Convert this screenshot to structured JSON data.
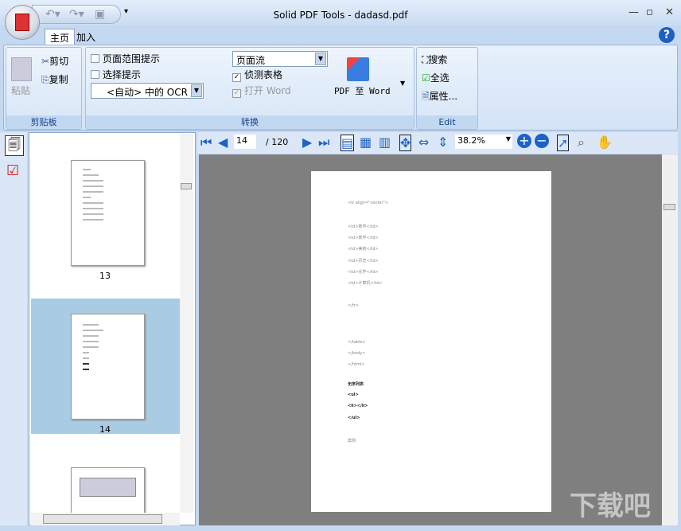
{
  "window": {
    "title": "Solid PDF Tools - dadasd.pdf",
    "minimize": "—",
    "maximize": "▫",
    "close": "✕"
  },
  "tabs": [
    "主页",
    "加入"
  ],
  "help": "?",
  "ribbon": {
    "clipboard": {
      "label": "剪贴板",
      "paste": "粘贴",
      "cut": "剪切",
      "copy": "复制"
    },
    "convert": {
      "label": "转换",
      "page_range_hint": "页面范围提示",
      "selection_hint": "选择提示",
      "ocr_select": "<自动> 中的 OCR",
      "layout_select": "页面流",
      "detect_tables": "侦测表格",
      "open_word": "打开 Word",
      "pdf_to_word": "PDF 至 Word",
      "detect_tables_checked": true,
      "open_word_checked": true
    },
    "edit": {
      "label": "Edit",
      "search": "搜索",
      "select_all": "全选",
      "properties": "属性..."
    }
  },
  "toolbar": {
    "current_page": "14",
    "total_pages": "/ 120",
    "zoom": "38.2%"
  },
  "thumbnails": [
    {
      "label": "13"
    },
    {
      "label": "14"
    }
  ],
  "page_text": [
    "<tr align=\"center\">",
    "<td>数学</td>",
    "<td>数学</td>",
    "<td>美術</td>",
    "<td>历史</td>",
    "<td>化学</td>",
    "<td>计算机</td>",
    "</tr>",
    "</table>",
    "</body>",
    "</html>",
    "无序列表",
    "<ul>",
    "<li></li>",
    "</ul>",
    "案例:"
  ],
  "watermark": "下载吧"
}
